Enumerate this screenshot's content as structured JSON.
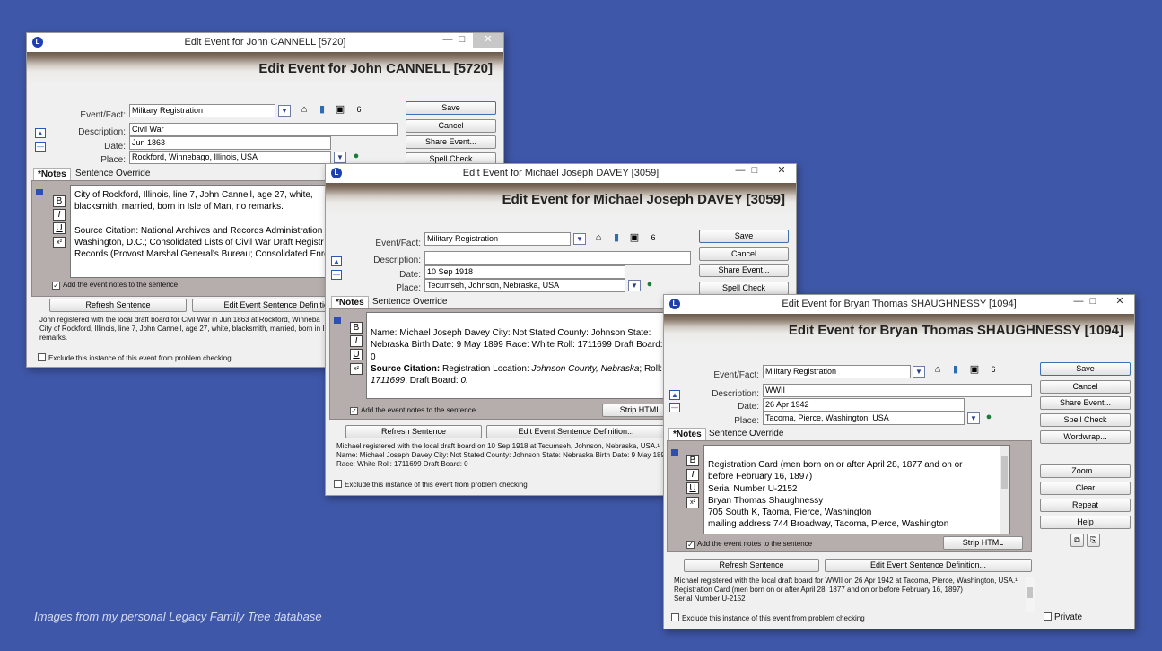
{
  "caption": "Images from my personal Legacy Family Tree database",
  "common": {
    "app_icon": "L",
    "minimize": "—",
    "maximize": "□",
    "close": "✕",
    "tab_notes": "*Notes",
    "tab_sentence": "Sentence Override",
    "label_event": "Event/Fact:",
    "label_description": "Description:",
    "label_date": "Date:",
    "label_place": "Place:",
    "save": "Save",
    "cancel": "Cancel",
    "share_event": "Share Event...",
    "spell_check": "Spell Check",
    "wordwrap": "Wordwrap...",
    "zoom": "Zoom...",
    "clear": "Clear",
    "repeat": "Repeat",
    "help": "Help",
    "strip_html": "Strip HTML",
    "refresh_sentence": "Refresh Sentence",
    "edit_sentence_def": "Edit Event Sentence Definition...",
    "add_notes_to_sentence": "Add the event notes to the sentence",
    "exclude_problem": "Exclude this instance of this event from problem checking",
    "private": "Private",
    "fmt_bold": "B",
    "fmt_italic": "I",
    "fmt_underline": "U",
    "fmt_super": "x²",
    "icons": [
      "home-icon",
      "books-icon",
      "people-icon",
      "calendar-icon",
      "globe-icon",
      "up-arrow-icon",
      "down-arrow-icon"
    ]
  },
  "win1": {
    "title": "Edit Event for John CANNELL [5720]",
    "heading": "Edit Event for John CANNELL [5720]",
    "event": "Military Registration",
    "description": "Civil War",
    "date": "Jun 1863",
    "place": "Rockford, Winnebago, Illinois, USA",
    "notes": [
      "City of Rockford, Illinois, line 7, John Cannell, age 27, white,",
      "blacksmith, married, born in Isle of Man, no remarks.",
      "",
      "Source Citation: National Archives and Records Administration",
      "Washington, D.C.; Consolidated Lists of Civil War Draft Registr",
      "Records (Provost Marshal General's Bureau; Consolidated Enro"
    ],
    "sentence": [
      "John registered with the local draft board for Civil War in Jun 1863 at Rockford, Winneba",
      "City of Rockford, Illinois, line 7, John Cannell, age 27, white, blacksmith, married, born in I",
      "remarks."
    ]
  },
  "win2": {
    "title": "Edit Event for Michael Joseph DAVEY [3059]",
    "heading": "Edit Event for Michael Joseph DAVEY [3059]",
    "event": "Military Registration",
    "description": "",
    "date": "10 Sep 1918",
    "place": "Tecumseh, Johnson, Nebraska, USA",
    "notes_line1": "Name: Michael Joseph Davey City: Not Stated County: Johnson State:",
    "notes_line2": "Nebraska Birth Date: 9 May 1899 Race: White Roll: 1711699 Draft Board:",
    "notes_line3": "0",
    "notes_src_label": "Source Citation:",
    "notes_src_a": " Registration Location: ",
    "notes_src_b": "Johnson County, Nebraska",
    "notes_src_c": "; Roll:",
    "notes_src_d": "1711699",
    "notes_src_e": "; Draft Board: ",
    "notes_src_f": "0.",
    "sentence": [
      "Michael registered with the local draft board on 10 Sep 1918 at Tecumseh, Johnson, Nebraska, USA.¹",
      "Name: Michael Joseph Davey City: Not Stated County: Johnson State: Nebraska Birth Date: 9 May 1899",
      "Race: White Roll: 1711699 Draft Board: 0"
    ]
  },
  "win3": {
    "title": "Edit Event for Bryan Thomas SHAUGHNESSY [1094]",
    "heading": "Edit Event for Bryan Thomas SHAUGHNESSY [1094]",
    "event": "Military Registration",
    "description": "WWII",
    "date": "26 Apr 1942",
    "place": "Tacoma, Pierce, Washington, USA",
    "notes": [
      "Registration Card (men born on or after April 28, 1877 and on or",
      "before February 16, 1897)",
      "Serial Number U-2152",
      "Bryan Thomas Shaughnessy",
      "705 South K, Taoma, Pierce, Washington",
      "mailing address  744 Broadway, Tacoma, Pierce, Washington"
    ],
    "sentence": [
      "Michael registered with the local draft board for WWII on 26 Apr 1942 at Tacoma, Pierce, Washington, USA.¹",
      "Registration Card (men born on or after April 28, 1877 and on or before February 16, 1897)",
      "Serial Number U-2152"
    ]
  }
}
